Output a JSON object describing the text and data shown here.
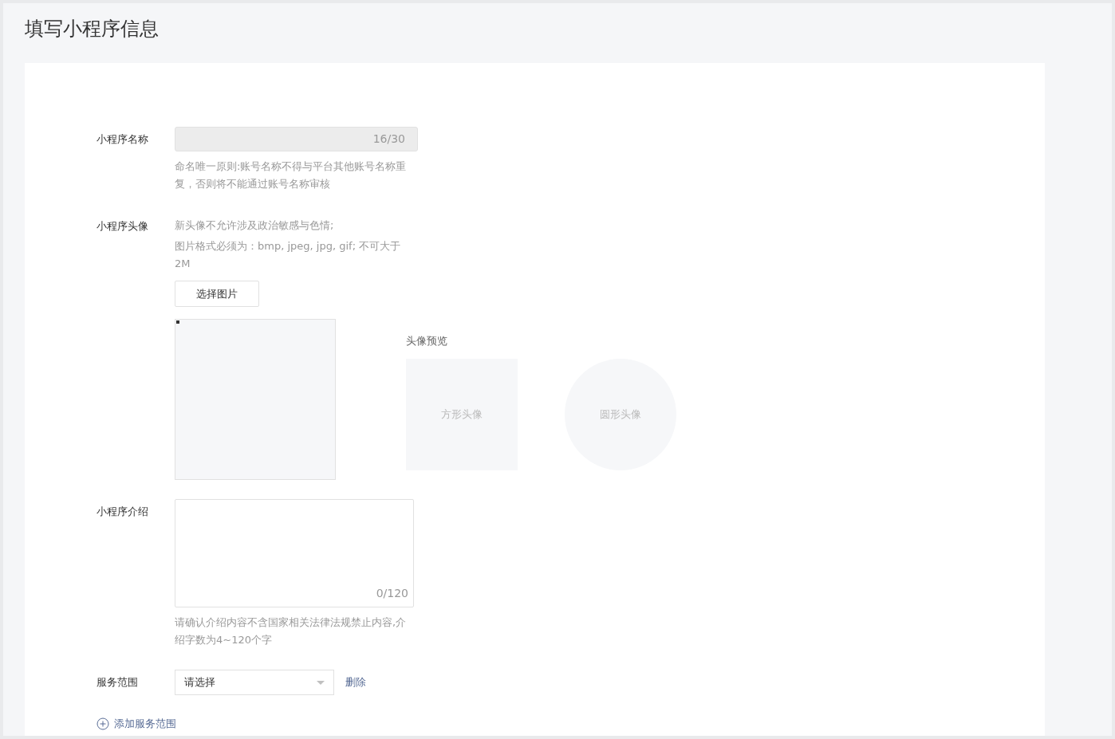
{
  "page_title": "填写小程序信息",
  "name_field": {
    "label": "小程序名称",
    "counter": "16/30",
    "disabled": true,
    "hints": [
      "命名唯一原则:账号名称不得与平台其他账号名称重复，否则将不能通过账号名称审核"
    ]
  },
  "avatar": {
    "label": "小程序头像",
    "hints": [
      "新头像不允许涉及政治敏感与色情;",
      "图片格式必须为：bmp, jpeg, jpg, gif; 不可大于2M"
    ],
    "button": "选择图片",
    "preview_title": "头像预览",
    "square_preview": "方形头像",
    "round_preview": "圆形头像"
  },
  "intro": {
    "label": "小程序介绍",
    "counter": "0/120",
    "hints": [
      "请确认介绍内容不含国家相关法律法规禁止内容,介绍字数为4~120个字"
    ]
  },
  "service": {
    "label": "服务范围",
    "placeholder": "请选择",
    "delete": "删除",
    "add": "添加服务范围"
  }
}
